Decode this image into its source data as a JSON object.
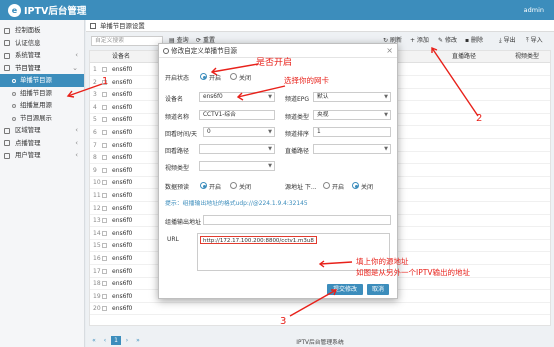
{
  "app": {
    "logo_letter": "e",
    "title": "IPTV后台管理",
    "user": "admin"
  },
  "sidebar": {
    "items": [
      {
        "label": "控制面板"
      },
      {
        "label": "认证信息"
      },
      {
        "label": "系统管理"
      },
      {
        "label": "节目管理"
      }
    ],
    "sub_items": [
      {
        "label": "单播节目源"
      },
      {
        "label": "组播节目源"
      },
      {
        "label": "组播复用源"
      },
      {
        "label": "节目源展示"
      }
    ],
    "lower_items": [
      {
        "label": "区域管理"
      },
      {
        "label": "点播管理"
      },
      {
        "label": "用户管理"
      }
    ]
  },
  "page": {
    "title": "单播节目源设置"
  },
  "toolbar": {
    "search_placeholder": "自定义搜索",
    "query": "查询",
    "reset": "重置",
    "refresh": "刷新",
    "add": "+ 添加",
    "edit": "修改",
    "delete": "删除",
    "export": "导出",
    "import": "导入"
  },
  "grid": {
    "headers": {
      "device": "设备名",
      "multicast_path": "直播路径",
      "video_type": "视频类型"
    },
    "rows": [
      "ens6f0",
      "ens6f0",
      "ens6f0",
      "ens6f0",
      "ens6f0",
      "ens6f0",
      "ens6f0",
      "ens6f0",
      "ens6f0",
      "ens6f0",
      "ens6f0",
      "ens6f0",
      "ens6f0",
      "ens6f0",
      "ens6f0",
      "ens6f0",
      "ens6f0",
      "ens6f0",
      "ens6f0",
      "ens6f0"
    ],
    "row_numbers": [
      "1",
      "2",
      "3",
      "4",
      "5",
      "6",
      "7",
      "8",
      "9",
      "10",
      "11",
      "12",
      "13",
      "14",
      "15",
      "16",
      "17",
      "18",
      "19",
      "20"
    ]
  },
  "pager": {
    "first": "«",
    "prev": "‹",
    "page": "1",
    "next": "›",
    "last": "»"
  },
  "footer": "IPTV后台管理系统",
  "modal": {
    "title": "修改自定义单播节目源",
    "close": "×",
    "enable_label": "开启状态",
    "enable_on": "开启",
    "enable_off": "关闭",
    "device_label": "设备名",
    "device_value": "ens6f0",
    "epg_label": "频道EPG",
    "epg_value": "默认",
    "channel_name_label": "频道名称",
    "channel_name_value": "CCTV1-综合",
    "channel_type_label": "频道类型",
    "channel_type_value": "央视",
    "replay_label": "回看时间/天",
    "replay_value": "0",
    "channel_order_label": "频道排序",
    "channel_order_value": "1",
    "replay_path_label": "回看路径",
    "live_path_label": "直播路径",
    "video_type_label": "视频类型",
    "preview_label": "数据预读",
    "preview_on": "开启",
    "preview_off": "关闭",
    "source_label": "源地址 下...",
    "source_on": "开启",
    "source_off": "关闭",
    "hint": "提示：组播输出地址的格式udp://@224.1.9.4:32145",
    "multicast_label": "组播输出地址",
    "url_label": "URL",
    "url_value": "http://172.17.100.200:8800/cctv1.m3u8",
    "submit": "提交修改",
    "cancel": "取消"
  },
  "annotations": {
    "a1": "1",
    "a2": "2",
    "a3": "3",
    "enable_note": "是否开启",
    "nic_note": "选择你的网卡",
    "url_note_1": "填上你的源地址",
    "url_note_2": "如图是从另外一个IPTV输出的地址",
    "color": "#e8211a"
  }
}
